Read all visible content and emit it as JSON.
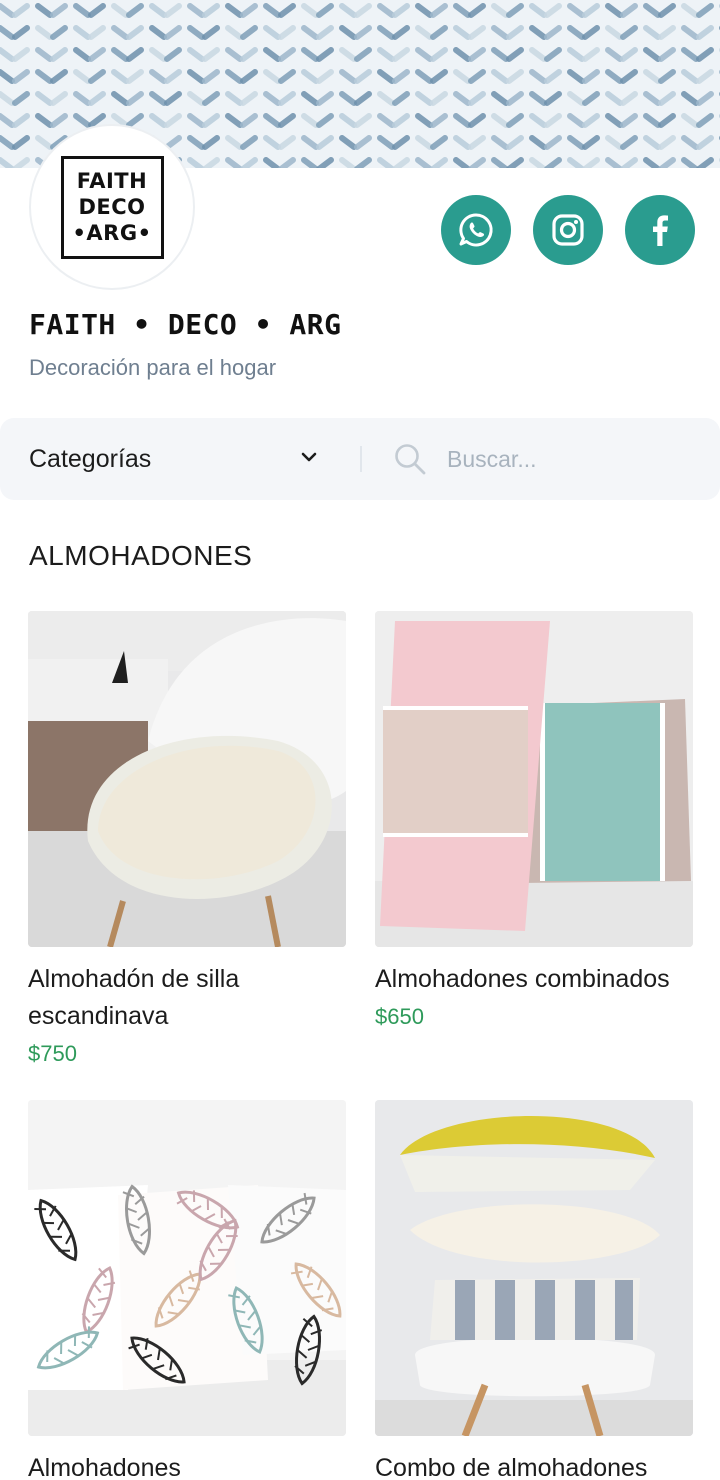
{
  "store": {
    "logo_lines": [
      "FAITH",
      "DECO",
      "•ARG•"
    ],
    "name": "FAITH • DECO • ARG",
    "tagline": "Decoración para el hogar"
  },
  "social": [
    {
      "name": "whatsapp",
      "icon": "whatsapp-icon"
    },
    {
      "name": "instagram",
      "icon": "instagram-icon"
    },
    {
      "name": "facebook",
      "icon": "facebook-icon"
    }
  ],
  "filters": {
    "category_label": "Categorías",
    "search_placeholder": "Buscar..."
  },
  "section": {
    "title": "ALMOHADONES"
  },
  "products": [
    {
      "title": "Almohadón de silla escandinava",
      "price": "$750",
      "image": "white fluffy cushion on white chair"
    },
    {
      "title": "Almohadones combinados",
      "price": "$650",
      "image": "pink and aqua pillows"
    },
    {
      "title": "Almohadones",
      "price": "",
      "image": "leaf print pillows"
    },
    {
      "title": "Combo de almohadones",
      "price": "",
      "image": "stacked pillows on chair"
    }
  ],
  "colors": {
    "accent": "#2a9c8f",
    "price": "#2e9a5a",
    "tagline": "#6f7f90"
  }
}
